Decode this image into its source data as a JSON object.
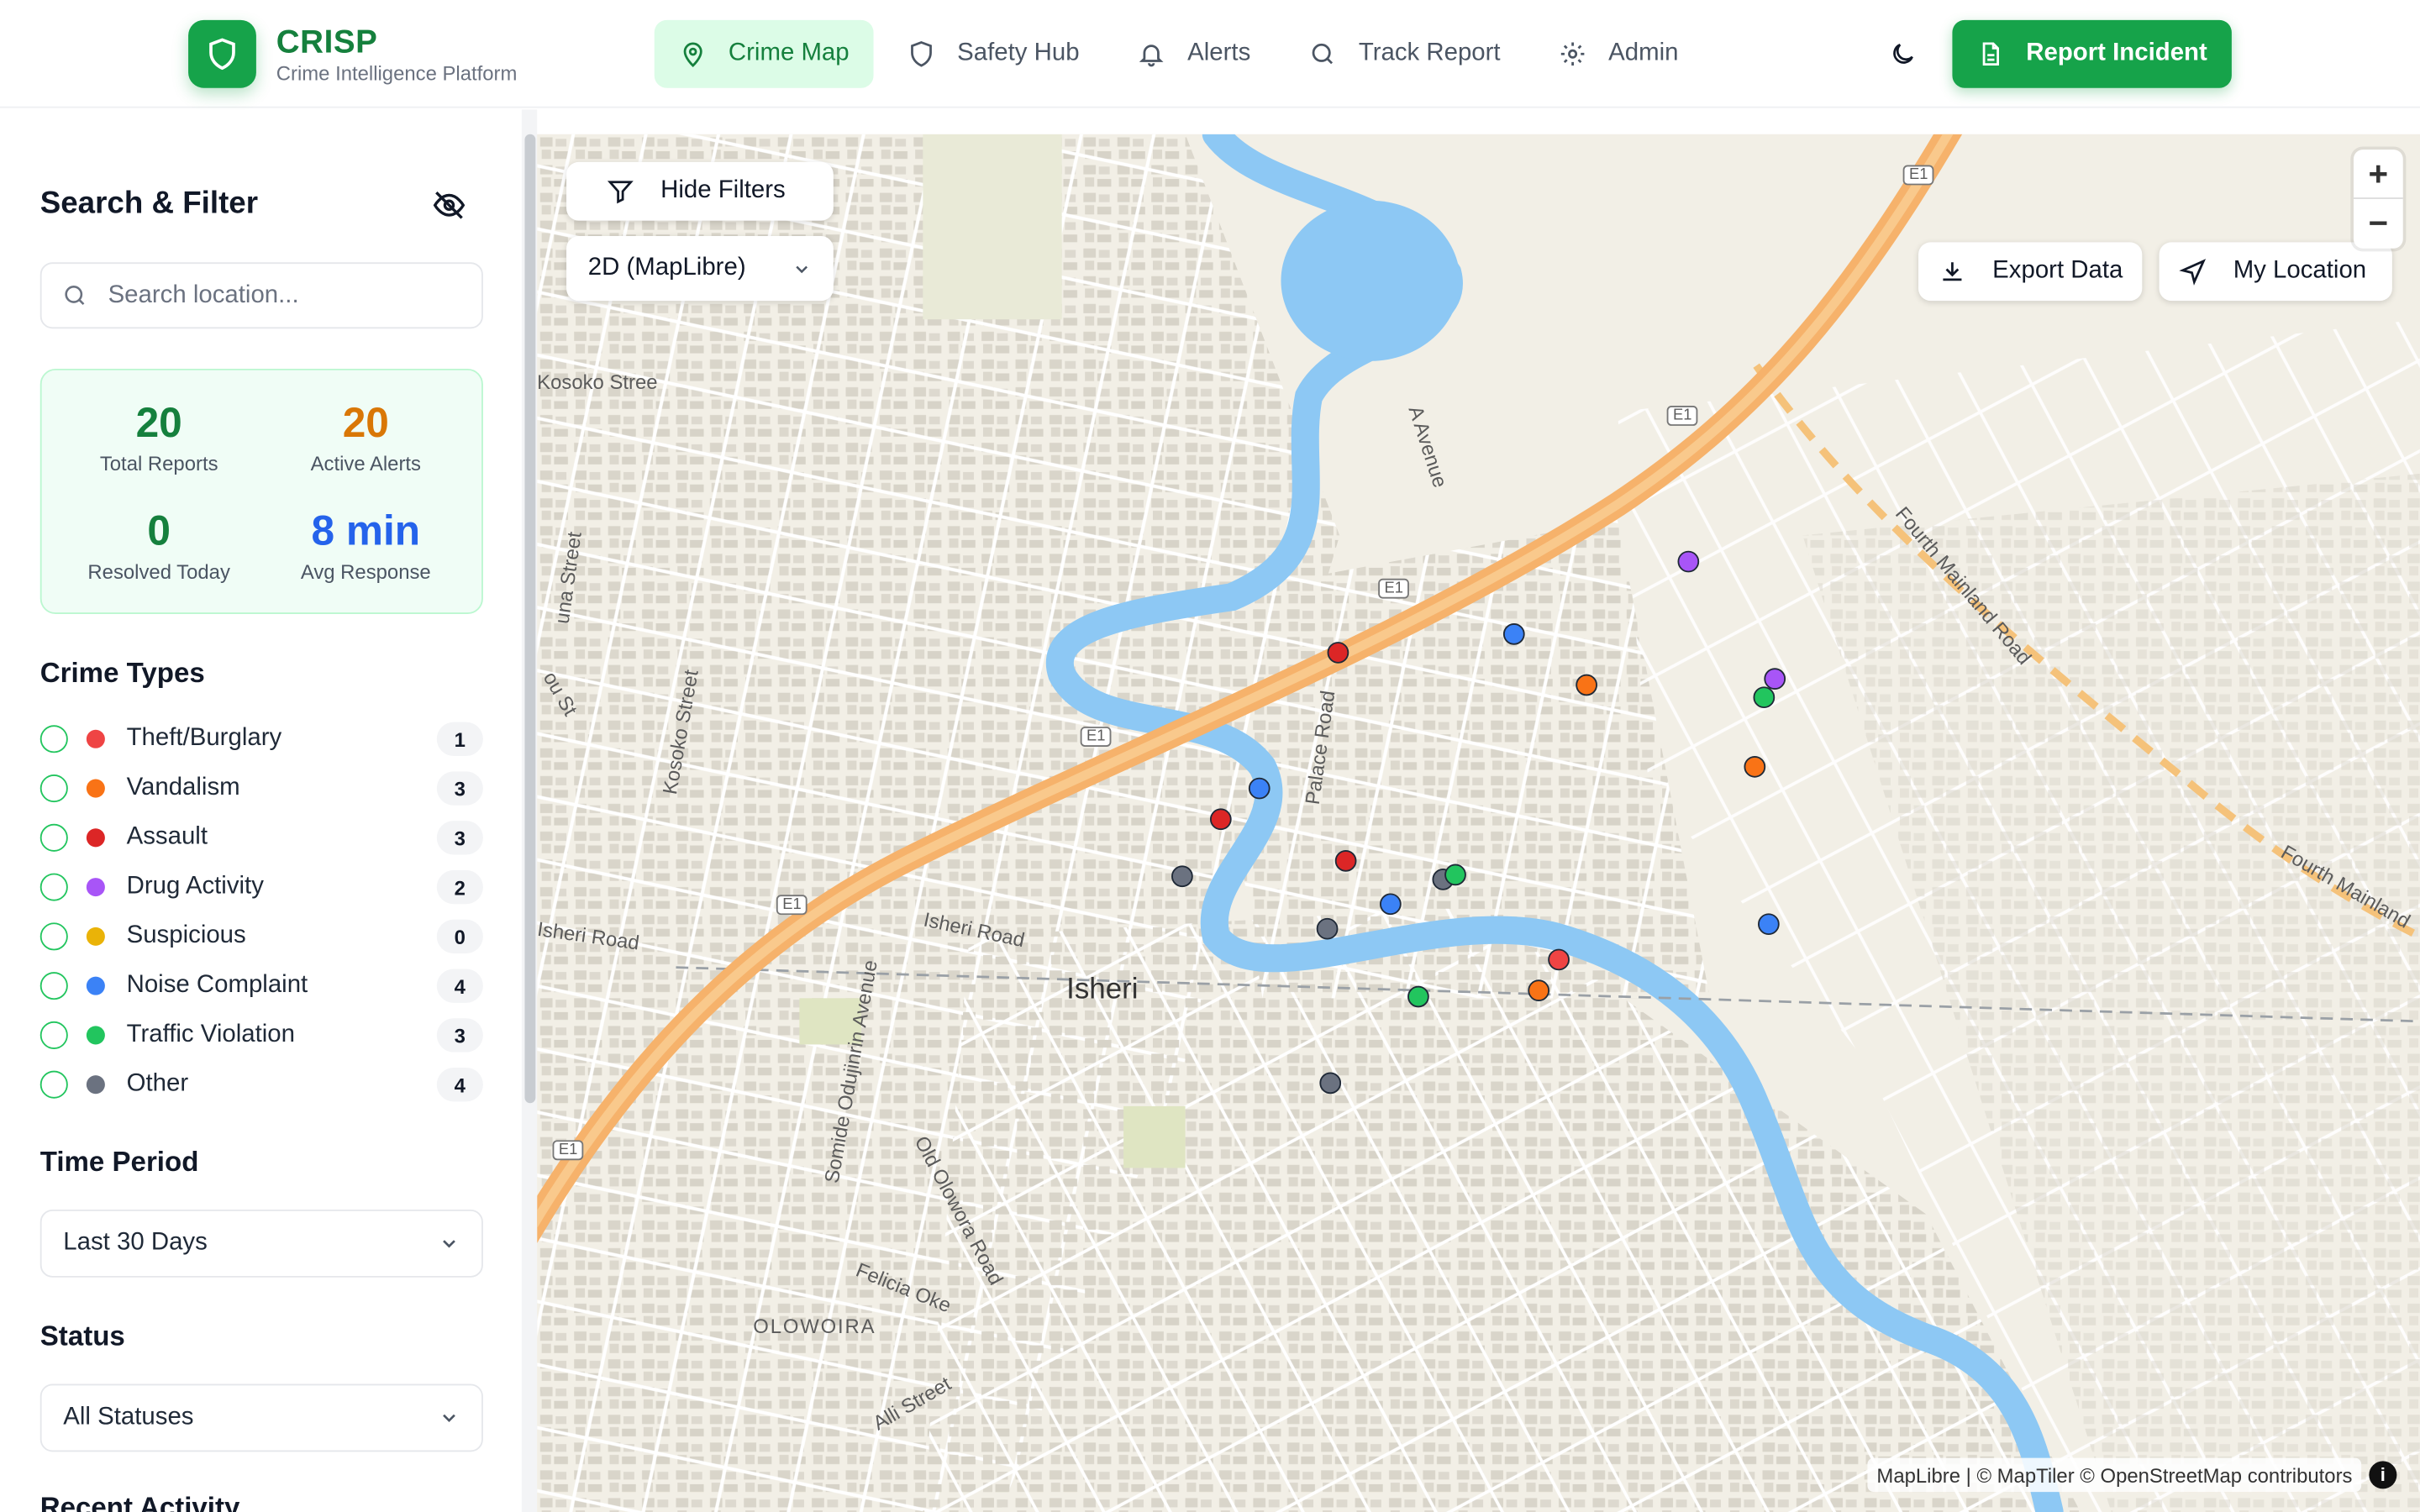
{
  "header": {
    "brand_title": "CRISP",
    "brand_subtitle": "Crime Intelligence Platform",
    "nav": [
      {
        "label": "Crime Map",
        "icon": "map-pin-icon",
        "active": true
      },
      {
        "label": "Safety Hub",
        "icon": "shield-icon",
        "active": false
      },
      {
        "label": "Alerts",
        "icon": "bell-icon",
        "active": false
      },
      {
        "label": "Track Report",
        "icon": "search-icon",
        "active": false
      },
      {
        "label": "Admin",
        "icon": "gear-icon",
        "active": false
      }
    ],
    "report_label": "Report Incident"
  },
  "sidebar": {
    "title": "Search & Filter",
    "search_placeholder": "Search location...",
    "stats": [
      {
        "value": "20",
        "label": "Total Reports",
        "color": "#15803d"
      },
      {
        "value": "20",
        "label": "Active Alerts",
        "color": "#d97706"
      },
      {
        "value": "0",
        "label": "Resolved Today",
        "color": "#15803d"
      },
      {
        "value": "8 min",
        "label": "Avg Response",
        "color": "#2563eb"
      }
    ],
    "crime_types_title": "Crime Types",
    "crime_types": [
      {
        "label": "Theft/Burglary",
        "count": "1",
        "color": "#ef4444"
      },
      {
        "label": "Vandalism",
        "count": "3",
        "color": "#f97316"
      },
      {
        "label": "Assault",
        "count": "3",
        "color": "#dc2626"
      },
      {
        "label": "Drug Activity",
        "count": "2",
        "color": "#a855f7"
      },
      {
        "label": "Suspicious",
        "count": "0",
        "color": "#eab308"
      },
      {
        "label": "Noise Complaint",
        "count": "4",
        "color": "#3b82f6"
      },
      {
        "label": "Traffic Violation",
        "count": "3",
        "color": "#22c55e"
      },
      {
        "label": "Other",
        "count": "4",
        "color": "#6b7280"
      }
    ],
    "time_title": "Time Period",
    "time_value": "Last 30 Days",
    "status_title": "Status",
    "status_value": "All Statuses",
    "recent_title": "Recent Activity"
  },
  "map": {
    "hide_filters_label": "Hide Filters",
    "view_mode": "2D (MapLibre)",
    "export_label": "Export Data",
    "location_label": "My Location",
    "zoom_in": "+",
    "zoom_out": "−",
    "attribution": "MapLibre | © MapTiler © OpenStreetMap contributors",
    "info": "i",
    "labels": {
      "isheri": "Isheri",
      "isheri_road_1": "Isheri Road",
      "isheri_road_2": "Isheri Road",
      "kosoko_street_1": "Kosoko Street",
      "kosoko_street_2": "Kosoko Stree",
      "palace_road": "Palace Road",
      "a_avenue": "A Avenue",
      "fourth_mainland_1": "Fourth Mainland Road",
      "fourth_mainland_2": "Fourth Mainland",
      "somide": "Somide Odujinrin Avenue",
      "old_olowora": "Old Olowora Road",
      "felicia": "Felicia Oke",
      "olowoira": "OLOWOIRA",
      "alli": "Alli Street",
      "e1": "E1",
      "una_street": "una Street",
      "ou_st": "ou St"
    },
    "markers": [
      {
        "category": "Drug Activity",
        "color": "#a855f7"
      },
      {
        "category": "Noise Complaint",
        "color": "#3b82f6"
      },
      {
        "category": "Assault",
        "color": "#dc2626"
      },
      {
        "category": "Vandalism",
        "color": "#f97316"
      },
      {
        "category": "Drug Activity",
        "color": "#a855f7"
      },
      {
        "category": "Traffic Violation",
        "color": "#22c55e"
      },
      {
        "category": "Vandalism",
        "color": "#f97316"
      },
      {
        "category": "Noise Complaint",
        "color": "#3b82f6"
      },
      {
        "category": "Assault",
        "color": "#dc2626"
      },
      {
        "category": "Other",
        "color": "#6b7280"
      },
      {
        "category": "Assault",
        "color": "#dc2626"
      },
      {
        "category": "Other",
        "color": "#6b7280"
      },
      {
        "category": "Traffic Violation",
        "color": "#22c55e"
      },
      {
        "category": "Noise Complaint",
        "color": "#3b82f6"
      },
      {
        "category": "Other",
        "color": "#6b7280"
      },
      {
        "category": "Noise Complaint",
        "color": "#3b82f6"
      },
      {
        "category": "Theft/Burglary",
        "color": "#ef4444"
      },
      {
        "category": "Vandalism",
        "color": "#f97316"
      },
      {
        "category": "Traffic Violation",
        "color": "#22c55e"
      },
      {
        "category": "Other",
        "color": "#6b7280"
      }
    ]
  }
}
